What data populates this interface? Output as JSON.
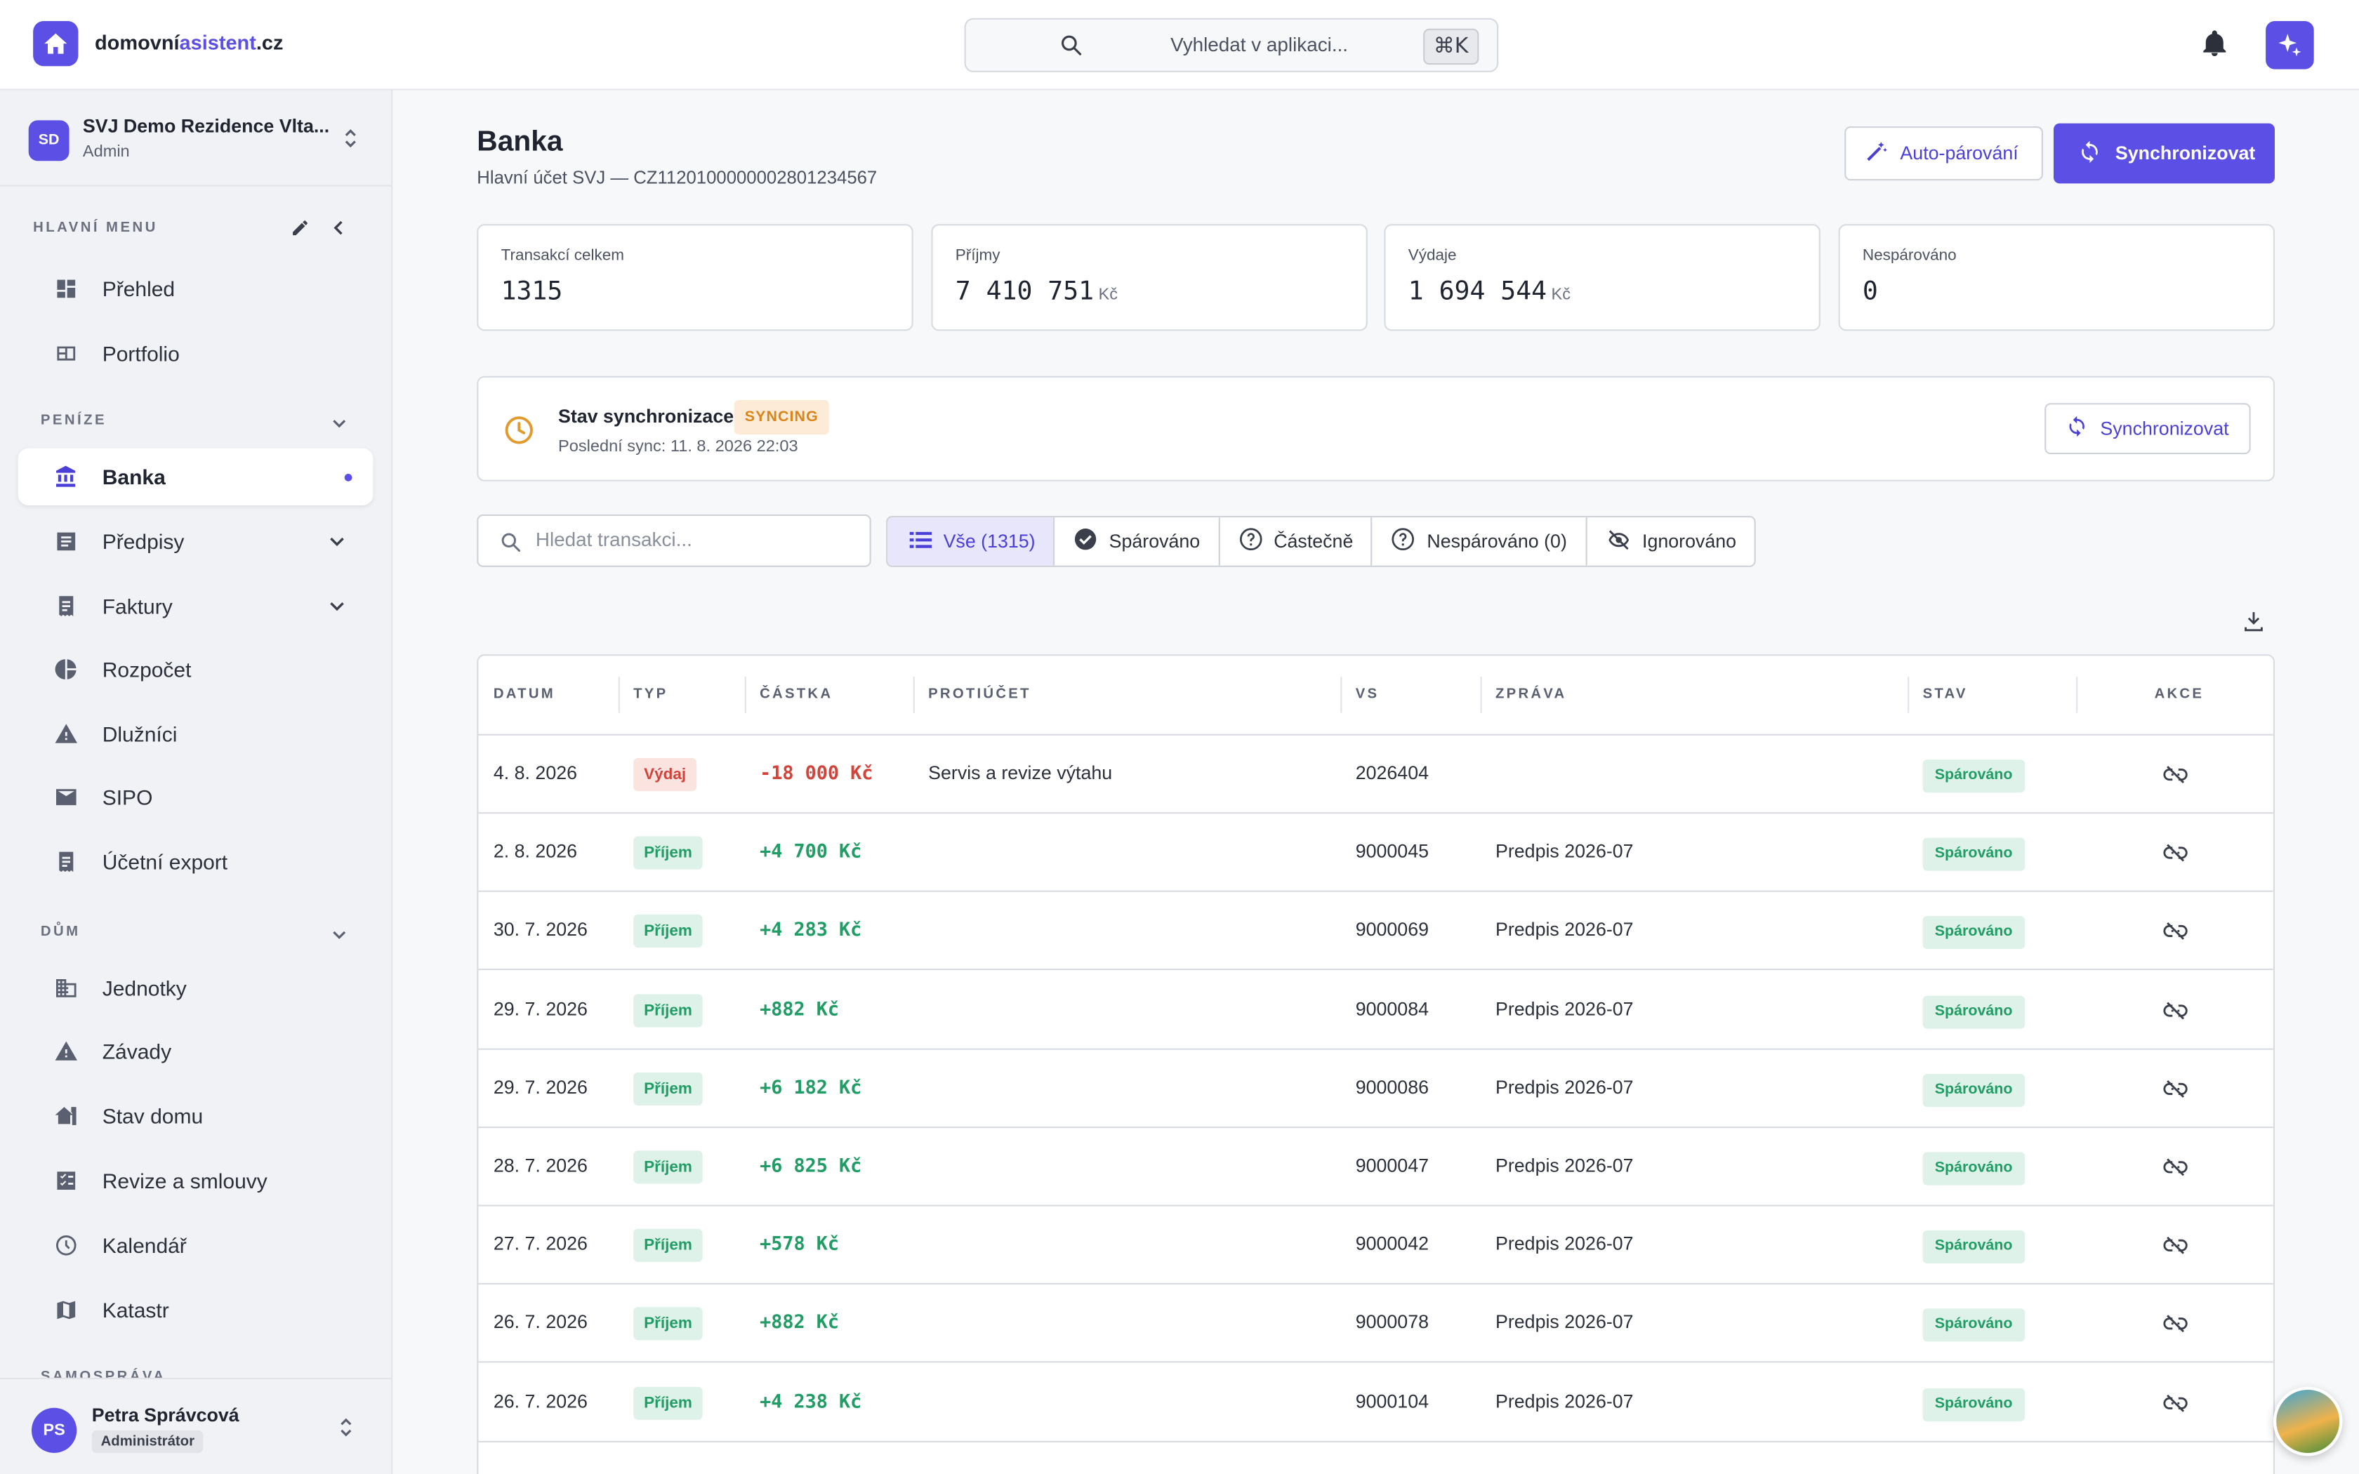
{
  "topbar": {
    "brand_a": "domovní",
    "brand_b": "asistent",
    "brand_c": ".cz",
    "search_placeholder": "Vyhledat v aplikaci...",
    "shortcut": "⌘K"
  },
  "sidebar": {
    "org_initials": "SD",
    "org_name": "SVJ Demo Rezidence Vlta...",
    "org_role": "Admin",
    "section_main": "HLAVNÍ MENU",
    "main_items": [
      {
        "label": "Přehled"
      },
      {
        "label": "Portfolio"
      }
    ],
    "section_money": "PENÍZE",
    "money_items": [
      {
        "label": "Banka"
      },
      {
        "label": "Předpisy"
      },
      {
        "label": "Faktury"
      },
      {
        "label": "Rozpočet"
      },
      {
        "label": "Dlužníci"
      },
      {
        "label": "SIPO"
      },
      {
        "label": "Účetní export"
      }
    ],
    "section_house": "DŮM",
    "house_items": [
      {
        "label": "Jednotky"
      },
      {
        "label": "Závady"
      },
      {
        "label": "Stav domu"
      },
      {
        "label": "Revize a smlouvy"
      },
      {
        "label": "Kalendář"
      },
      {
        "label": "Katastr"
      }
    ],
    "section_gov": "SAMOSPRÁVA",
    "user_initials": "PS",
    "user_name": "Petra Správcová",
    "user_role": "Administrátor"
  },
  "page": {
    "title": "Banka",
    "subtitle": "Hlavní účet SVJ — CZ1120100000002801234567",
    "auto_btn": "Auto-párování",
    "sync_btn": "Synchronizovat"
  },
  "stats": [
    {
      "label": "Transakcí celkem",
      "value": "1315",
      "unit": ""
    },
    {
      "label": "Příjmy",
      "value": "7 410 751",
      "unit": "Kč"
    },
    {
      "label": "Výdaje",
      "value": "1 694 544",
      "unit": "Kč"
    },
    {
      "label": "Nespárováno",
      "value": "0",
      "unit": ""
    }
  ],
  "sync": {
    "label": "Stav synchronizace:",
    "status": "SYNCING",
    "last": "Poslední sync: 11. 8. 2026 22:03",
    "button": "Synchronizovat"
  },
  "filter": {
    "search_placeholder": "Hledat transakci...",
    "tabs": [
      "Vše (1315)",
      "Spárováno",
      "Částečně",
      "Nespárováno (0)",
      "Ignorováno"
    ]
  },
  "table": {
    "headers": [
      "DATUM",
      "TYP",
      "ČÁSTKA",
      "PROTIÚČET",
      "VS",
      "ZPRÁVA",
      "STAV",
      "AKCE"
    ],
    "rows": [
      {
        "date": "4. 8. 2026",
        "type": "Výdaj",
        "kind": "exp",
        "amount": "-18 000 Kč",
        "counter": "Servis a revize výtahu",
        "vs": "2026404",
        "msg": "",
        "status": "Spárováno"
      },
      {
        "date": "2. 8. 2026",
        "type": "Příjem",
        "kind": "inc",
        "amount": "+4 700 Kč",
        "counter": "",
        "vs": "9000045",
        "msg": "Predpis 2026-07",
        "status": "Spárováno"
      },
      {
        "date": "30. 7. 2026",
        "type": "Příjem",
        "kind": "inc",
        "amount": "+4 283 Kč",
        "counter": "",
        "vs": "9000069",
        "msg": "Predpis 2026-07",
        "status": "Spárováno"
      },
      {
        "date": "29. 7. 2026",
        "type": "Příjem",
        "kind": "inc",
        "amount": "+882 Kč",
        "counter": "",
        "vs": "9000084",
        "msg": "Predpis 2026-07",
        "status": "Spárováno"
      },
      {
        "date": "29. 7. 2026",
        "type": "Příjem",
        "kind": "inc",
        "amount": "+6 182 Kč",
        "counter": "",
        "vs": "9000086",
        "msg": "Predpis 2026-07",
        "status": "Spárováno"
      },
      {
        "date": "28. 7. 2026",
        "type": "Příjem",
        "kind": "inc",
        "amount": "+6 825 Kč",
        "counter": "",
        "vs": "9000047",
        "msg": "Predpis 2026-07",
        "status": "Spárováno"
      },
      {
        "date": "27. 7. 2026",
        "type": "Příjem",
        "kind": "inc",
        "amount": "+578 Kč",
        "counter": "",
        "vs": "9000042",
        "msg": "Predpis 2026-07",
        "status": "Spárováno"
      },
      {
        "date": "26. 7. 2026",
        "type": "Příjem",
        "kind": "inc",
        "amount": "+882 Kč",
        "counter": "",
        "vs": "9000078",
        "msg": "Predpis 2026-07",
        "status": "Spárováno"
      },
      {
        "date": "26. 7. 2026",
        "type": "Příjem",
        "kind": "inc",
        "amount": "+4 238 Kč",
        "counter": "",
        "vs": "9000104",
        "msg": "Predpis 2026-07",
        "status": "Spárováno"
      }
    ]
  },
  "colors": {
    "accent": "#5b4fe6",
    "income": "#1f9d64",
    "expense": "#d4433a",
    "syncing": "#d9851a"
  }
}
